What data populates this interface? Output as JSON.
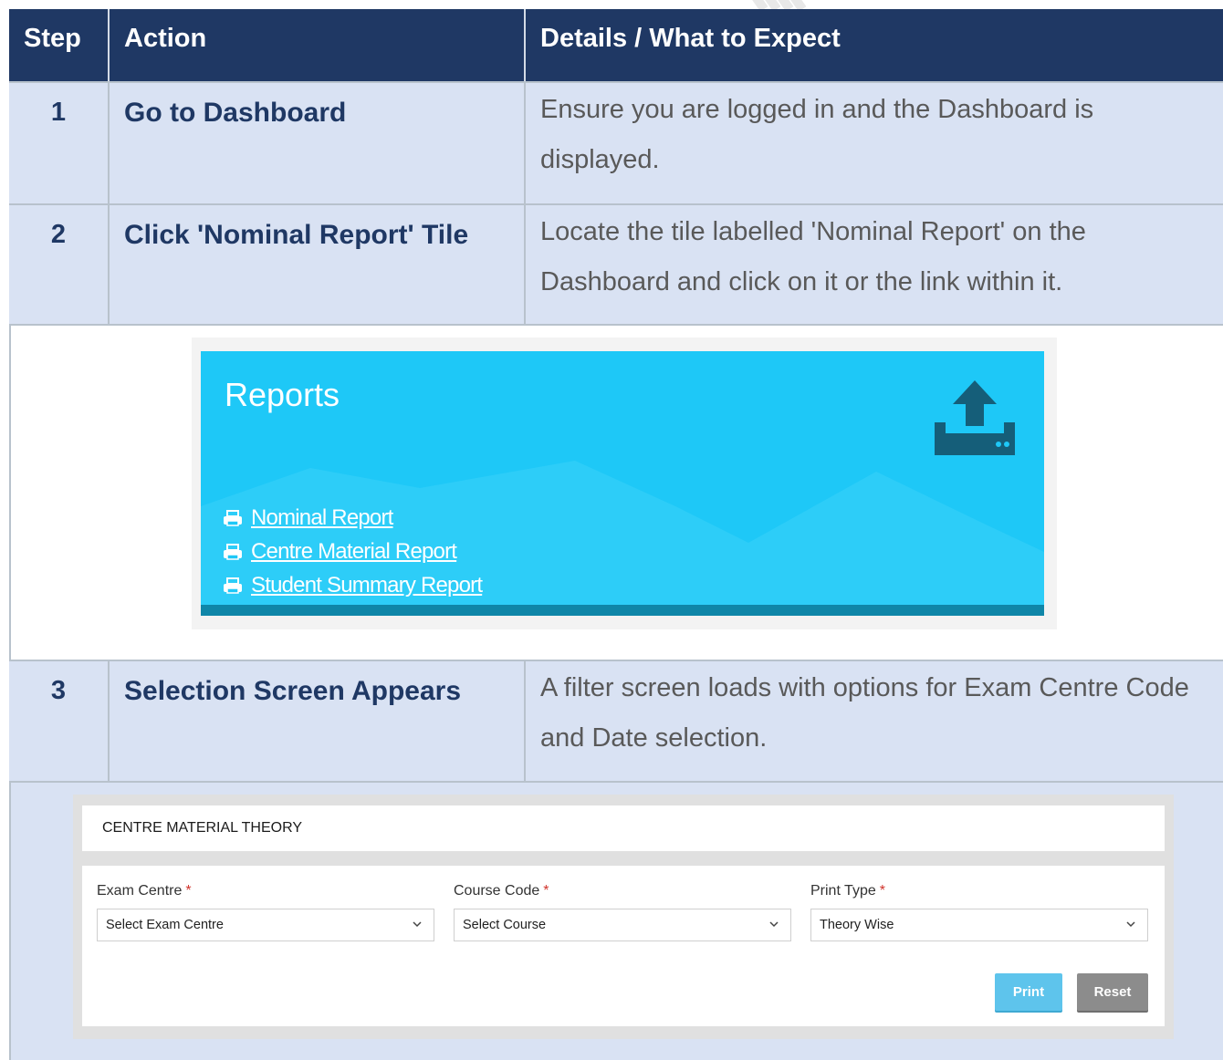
{
  "header": {
    "step": "Step",
    "action": "Action",
    "details": "Details / What to Expect"
  },
  "steps": [
    {
      "num": "1",
      "action": "Go to Dashboard",
      "details": "Ensure you are logged in and the Dashboard is displayed."
    },
    {
      "num": "2",
      "action": "Click 'Nominal Report' Tile",
      "details": "Locate the tile labelled 'Nominal Report' on the Dashboard and click on it or the link within it."
    },
    {
      "num": "3",
      "action": "Selection Screen Appears",
      "details": "A filter screen loads with options for Exam Centre Code and Date selection."
    }
  ],
  "reports_tile": {
    "title": "Reports",
    "icon": "upload-tray-icon",
    "links": [
      {
        "label": "Nominal Report",
        "icon": "printer-icon"
      },
      {
        "label": "Centre Material Report",
        "icon": "printer-icon"
      },
      {
        "label": "Student Summary Report",
        "icon": "printer-icon"
      }
    ],
    "colors": {
      "background": "#1ec8f7",
      "bar": "#0f86a8"
    }
  },
  "material_form": {
    "title": "CENTRE MATERIAL THEORY",
    "required_mark": "*",
    "fields": [
      {
        "label": "Exam Centre",
        "value": "Select Exam Centre"
      },
      {
        "label": "Course Code",
        "value": "Select Course"
      },
      {
        "label": "Print Type",
        "value": "Theory Wise"
      }
    ],
    "print_label": "Print",
    "reset_label": "Reset"
  },
  "colors": {
    "header_bg": "#1f3864",
    "row_bg": "#d9e2f3",
    "accent_text": "#1f3864"
  }
}
